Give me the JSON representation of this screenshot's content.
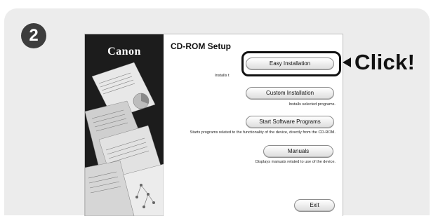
{
  "step_number": "2",
  "window": {
    "brand": "Canon",
    "title": "CD-ROM Setup",
    "buttons": {
      "easy_installation": "Easy Installation",
      "custom_installation": "Custom Installation",
      "start_software_programs": "Start Software Programs",
      "manuals": "Manuals",
      "exit": "Exit"
    },
    "descriptions": {
      "easy_installation": "Installs t",
      "custom_installation": "Installs selected programs.",
      "start_software_programs": "Starts programs related to the functionality of the device, directly from the CD-ROM.",
      "manuals": "Displays manuals related to use of the device."
    }
  },
  "callout": {
    "label": "Click!"
  },
  "colors": {
    "panel": "#ececec",
    "side": "#1c1c1c",
    "callout": "#111111"
  }
}
